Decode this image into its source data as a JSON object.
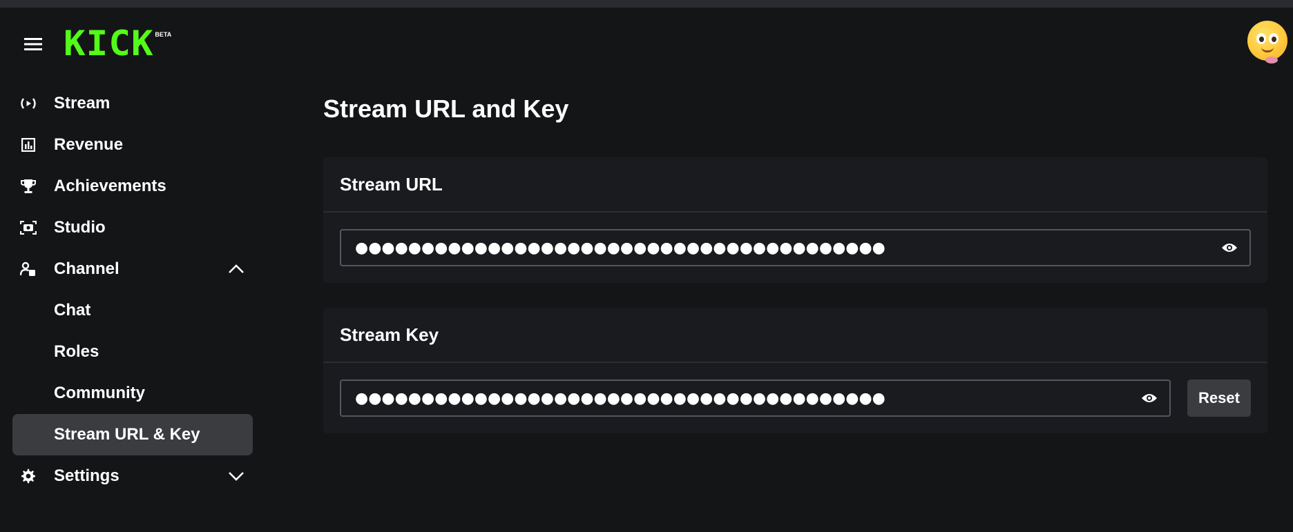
{
  "brand": {
    "logo_text": "KICK",
    "beta_label": "BETA",
    "accent_color": "#53fc18"
  },
  "header": {
    "menu_icon": "hamburger-menu-icon",
    "avatar_icon": "emoji-avatar"
  },
  "sidebar": {
    "items": [
      {
        "label": "Stream",
        "icon": "broadcast-icon"
      },
      {
        "label": "Revenue",
        "icon": "bar-chart-icon"
      },
      {
        "label": "Achievements",
        "icon": "trophy-icon"
      },
      {
        "label": "Studio",
        "icon": "studio-camera-icon"
      },
      {
        "label": "Channel",
        "icon": "user-settings-icon",
        "expanded": true
      },
      {
        "label": "Chat"
      },
      {
        "label": "Roles"
      },
      {
        "label": "Community"
      },
      {
        "label": "Stream URL & Key",
        "active": true
      },
      {
        "label": "Settings",
        "icon": "gear-icon",
        "expanded": false
      }
    ]
  },
  "main": {
    "title": "Stream URL and Key",
    "stream_url": {
      "heading": "Stream URL",
      "masked_value": "●●●●●●●●●●●●●●●●●●●●●●●●●●●●●●●●●●●●●●●●"
    },
    "stream_key": {
      "heading": "Stream Key",
      "masked_value": "●●●●●●●●●●●●●●●●●●●●●●●●●●●●●●●●●●●●●●●●",
      "reset_label": "Reset"
    }
  }
}
